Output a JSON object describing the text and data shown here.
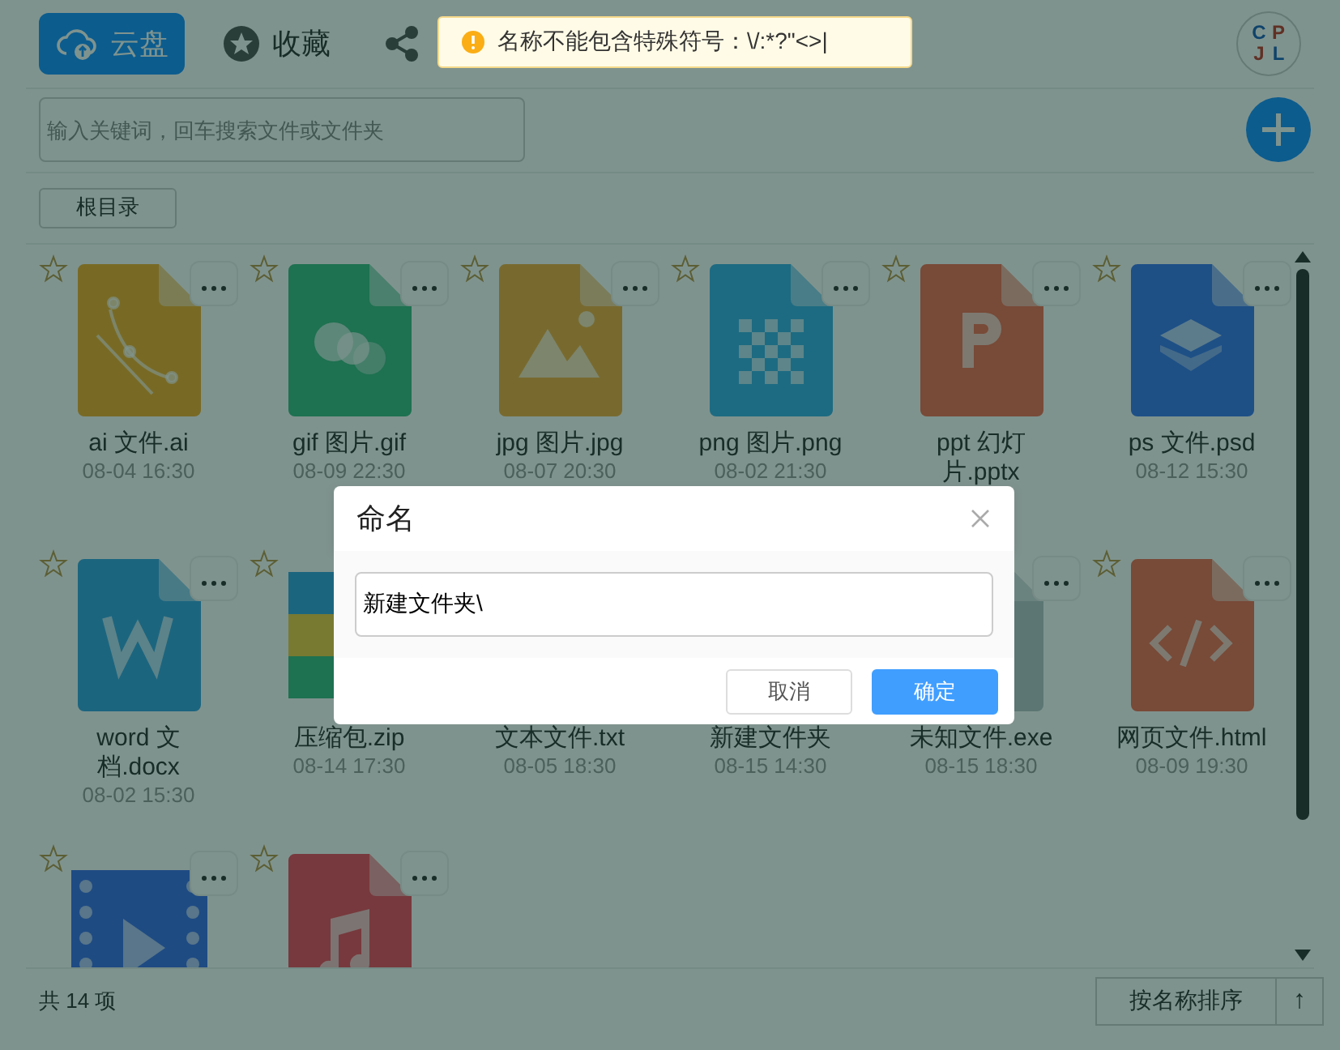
{
  "tabs": [
    {
      "kind": "cloud",
      "label": "云盘",
      "selected": true
    },
    {
      "kind": "star",
      "label": "收藏",
      "selected": false
    },
    {
      "kind": "share",
      "selected": false
    }
  ],
  "toast": {
    "text": "名称不能包含特殊符号：\\/:*?\"<>|"
  },
  "avatar": {
    "letters": [
      "C",
      "P",
      "J",
      "L"
    ]
  },
  "search": {
    "placeholder": "输入关键词，回车搜索文件或文件夹"
  },
  "breadcrumb": [
    "根目录"
  ],
  "files": [
    {
      "kind": "ai",
      "name": "ai 文件.ai",
      "date": "08-04 16:30",
      "starred": false
    },
    {
      "kind": "gif",
      "name": "gif 图片.gif",
      "date": "08-09 22:30",
      "starred": false
    },
    {
      "kind": "jpg",
      "name": "jpg 图片.jpg",
      "date": "08-07 20:30",
      "starred": false
    },
    {
      "kind": "png",
      "name": "png 图片.png",
      "date": "08-02 21:30",
      "starred": false
    },
    {
      "kind": "ppt",
      "name": "ppt 幻灯片.pptx",
      "starred": false
    },
    {
      "kind": "psd",
      "name": "ps 文件.psd",
      "date": "08-12 15:30",
      "starred": false
    },
    {
      "kind": "word",
      "name": "word 文档.docx",
      "date": "08-02 15:30",
      "starred": false
    },
    {
      "kind": "zip",
      "name": "压缩包.zip",
      "date": "08-14 17:30",
      "starred": false
    },
    {
      "kind": "txt",
      "name": "文本文件.txt",
      "date": "08-05 18:30"
    },
    {
      "kind": "folder",
      "name": "新建文件夹",
      "date": "08-15 14:30"
    },
    {
      "kind": "exe",
      "name": "未知文件.exe",
      "date": "08-15 18:30"
    },
    {
      "kind": "html",
      "name": "网页文件.html",
      "date": "08-09 19:30",
      "starred": false
    },
    {
      "kind": "video",
      "starred": false
    },
    {
      "kind": "music",
      "starred": false
    }
  ],
  "footer": {
    "count": "共 14 项",
    "sort_label": "按名称排序",
    "sort_direction": "↑"
  },
  "dialog": {
    "title": "命名",
    "value": "新建文件夹\\",
    "buttons": [
      {
        "kind": "cancel",
        "label": "取消"
      },
      {
        "kind": "confirm",
        "label": "确定"
      }
    ]
  }
}
